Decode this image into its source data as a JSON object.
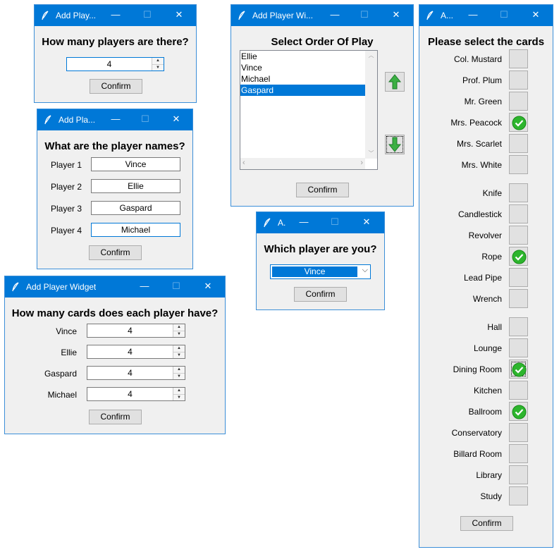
{
  "w1": {
    "title": "Add Play...",
    "heading": "How many players are there?",
    "value": "4",
    "confirm": "Confirm"
  },
  "w2": {
    "title": "Add Pla...",
    "heading": "What are the player names?",
    "rows": [
      {
        "label": "Player 1",
        "value": "Vince"
      },
      {
        "label": "Player 2",
        "value": "Ellie"
      },
      {
        "label": "Player 3",
        "value": "Gaspard"
      },
      {
        "label": "Player 4",
        "value": "Michael"
      }
    ],
    "confirm": "Confirm"
  },
  "w3": {
    "title": "Add Player Widget",
    "heading": "How many cards does each player have?",
    "rows": [
      {
        "label": "Vince",
        "value": "4"
      },
      {
        "label": "Ellie",
        "value": "4"
      },
      {
        "label": "Gaspard",
        "value": "4"
      },
      {
        "label": "Michael",
        "value": "4"
      }
    ],
    "confirm": "Confirm"
  },
  "w4": {
    "title": "Add Player Wi...",
    "heading": "Select Order Of Play",
    "items": [
      "Ellie",
      "Vince",
      "Michael",
      "Gaspard"
    ],
    "selected_index": 3,
    "confirm": "Confirm"
  },
  "w5": {
    "title": "A.",
    "heading": "Which player are you?",
    "selected": "Vince",
    "confirm": "Confirm"
  },
  "w6": {
    "title": "A...",
    "heading": "Please select the cards",
    "suspects": [
      {
        "name": "Col. Mustard",
        "checked": false
      },
      {
        "name": "Prof. Plum",
        "checked": false
      },
      {
        "name": "Mr. Green",
        "checked": false
      },
      {
        "name": "Mrs. Peacock",
        "checked": true
      },
      {
        "name": "Mrs. Scarlet",
        "checked": false
      },
      {
        "name": "Mrs. White",
        "checked": false
      }
    ],
    "weapons": [
      {
        "name": "Knife",
        "checked": false
      },
      {
        "name": "Candlestick",
        "checked": false
      },
      {
        "name": "Revolver",
        "checked": false
      },
      {
        "name": "Rope",
        "checked": true
      },
      {
        "name": "Lead Pipe",
        "checked": false
      },
      {
        "name": "Wrench",
        "checked": false
      }
    ],
    "rooms": [
      {
        "name": "Hall",
        "checked": false
      },
      {
        "name": "Lounge",
        "checked": false
      },
      {
        "name": "Dining Room",
        "checked": true
      },
      {
        "name": "Kitchen",
        "checked": false
      },
      {
        "name": "Ballroom",
        "checked": true
      },
      {
        "name": "Conservatory",
        "checked": false
      },
      {
        "name": "Billard Room",
        "checked": false
      },
      {
        "name": "Library",
        "checked": false
      },
      {
        "name": "Study",
        "checked": false
      }
    ],
    "confirm": "Confirm"
  },
  "colors": {
    "titlebar": "#0078d7",
    "check_green": "#2db52d",
    "arrow_green": "#3cb043"
  },
  "icons": {
    "window": "feather-icon",
    "minimize": "minimize-icon",
    "maximize": "maximize-icon",
    "close": "close-icon",
    "check": "check-icon",
    "up": "arrow-up-icon",
    "down": "arrow-down-icon"
  }
}
